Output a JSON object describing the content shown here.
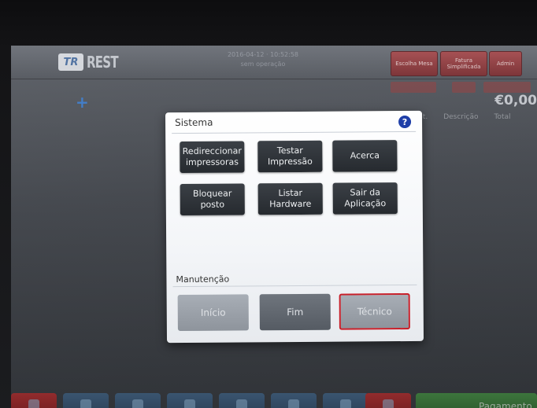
{
  "app": {
    "logo_badge": "TR",
    "logo_text": "REST",
    "top_info_line1": "2016-04-12 · 10:52:58",
    "top_info_line2": "sem operação",
    "top_buttons": [
      "Escolha Mesa",
      "Fatura Simplificada",
      "Admin"
    ],
    "total": "€0,00",
    "add_symbol": "+",
    "table_columns": [
      "Qnt.",
      "Descrição",
      "Total"
    ],
    "payment_label": "Pagamento"
  },
  "dialog": {
    "title": "Sistema",
    "help_symbol": "?",
    "buttons": [
      {
        "label": "Redireccionar impressoras"
      },
      {
        "label": "Testar Impressão"
      },
      {
        "label": "Acerca"
      },
      {
        "label": "Bloquear posto"
      },
      {
        "label": "Listar Hardware"
      },
      {
        "label": "Sair da Aplicação"
      }
    ],
    "section_label": "Manutenção",
    "maintenance": [
      {
        "label": "Início"
      },
      {
        "label": "Fim"
      },
      {
        "label": "Técnico"
      }
    ]
  },
  "icons": {
    "help": "question-mark-icon",
    "plus": "plus-icon"
  },
  "colors": {
    "help_icon": "#1f3fa8",
    "selected_border": "#c8202a",
    "dialog_button": "#2f3439"
  }
}
